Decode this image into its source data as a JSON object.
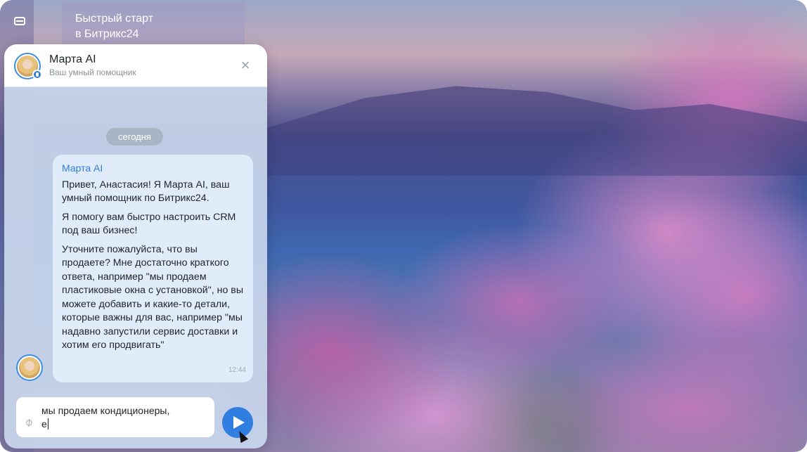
{
  "background": {
    "quick_start": {
      "line1": "Быстрый старт",
      "line2": "в Битрикс24"
    },
    "sidebar_icon": "inbox-icon"
  },
  "chat": {
    "title": "Марта AI",
    "subtitle": "Ваш умный помощник",
    "close_icon": "close-icon",
    "date_label": "сегодня",
    "message": {
      "sender": "Марта AI",
      "paragraphs": [
        "Привет, Анастасия! Я Марта AI, ваш умный помощник по Битрикс24.",
        "Я помогу вам быстро настроить CRM под ваш бизнес!",
        "Уточните пожалуйста, что вы продаете? Мне достаточно краткого ответа, например \"мы продаем пластиковые окна с установкой\", но вы можете добавить и какие-то детали, которые важны для вас, например \"мы надавно запустили сервис доставки и хотим его продвигать\""
      ],
      "time": "12:44"
    },
    "input": {
      "value": "мы продаем кондиционеры,\nе"
    }
  },
  "colors": {
    "accent": "#2f7ee0",
    "bubble": "#e1ecfb",
    "panel": "#c8d6ec"
  }
}
